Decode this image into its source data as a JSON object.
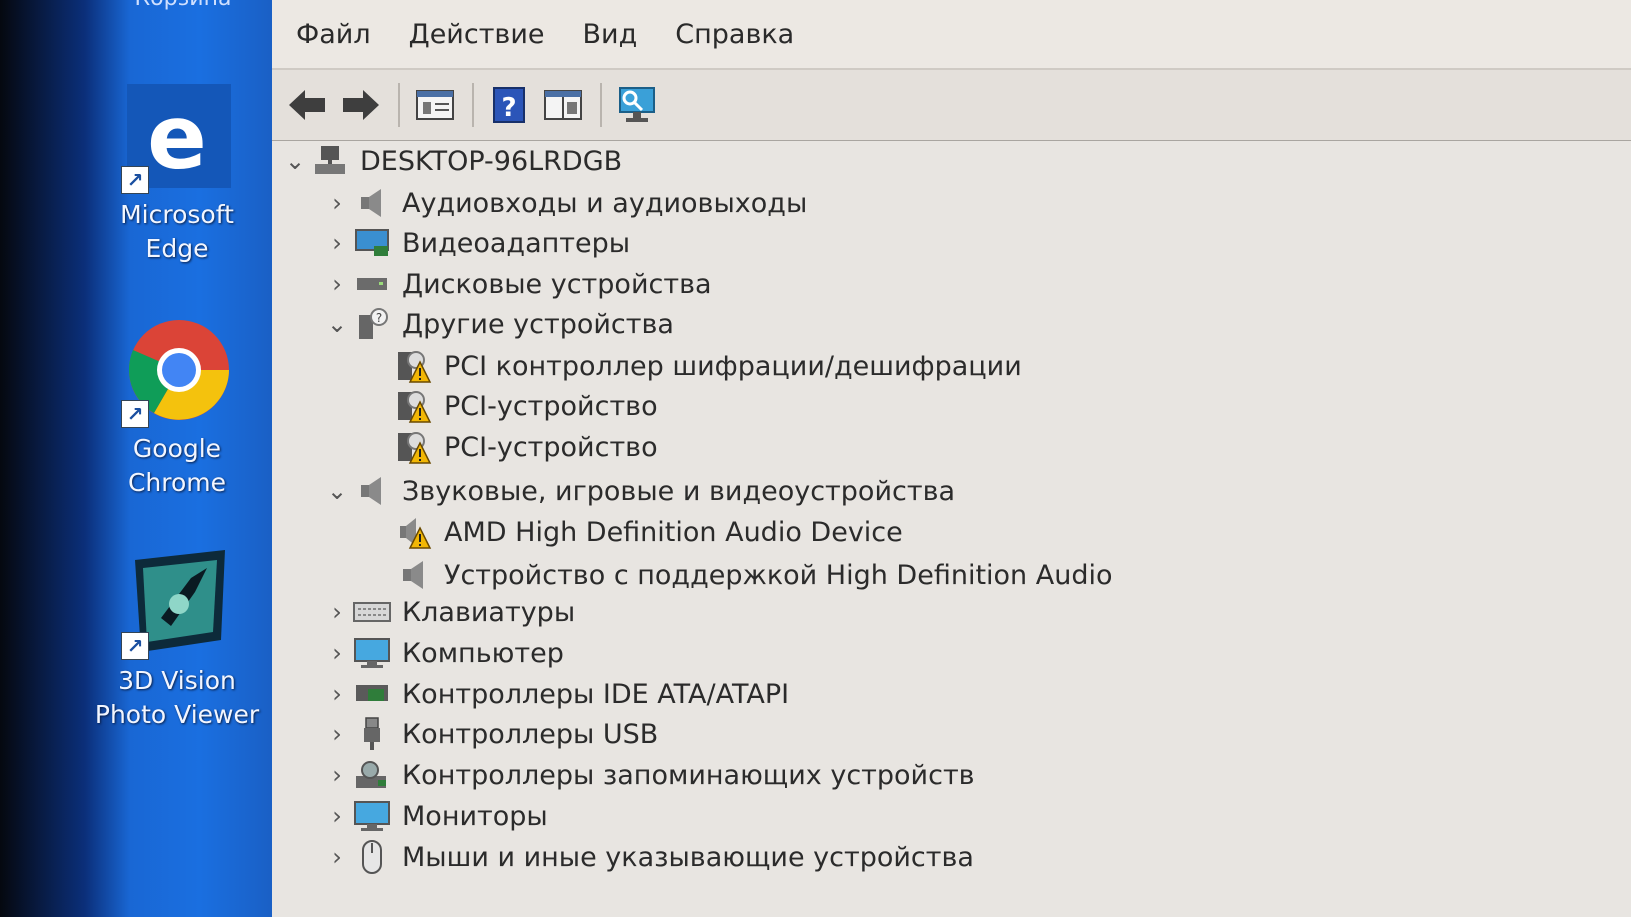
{
  "desktop": {
    "partial_top_label": "Корзина",
    "shortcuts": [
      {
        "label": "Microsoft\nEdge",
        "icon": "edge-icon"
      },
      {
        "label": "Google\nChrome",
        "icon": "chrome-icon"
      },
      {
        "label": "3D Vision\nPhoto Viewer",
        "icon": "3d-vision-icon"
      }
    ]
  },
  "menu": {
    "file": "Файл",
    "action": "Действие",
    "view": "Вид",
    "help": "Справка"
  },
  "toolbar": {
    "icons": [
      "back-arrow-icon",
      "forward-arrow-icon",
      "properties-icon",
      "help-icon",
      "console-tree-icon",
      "scan-hardware-icon"
    ]
  },
  "tree": {
    "root": "DESKTOP-96LRDGB",
    "items": [
      {
        "label": "Аудиовходы и аудиовыходы",
        "expanded": false
      },
      {
        "label": "Видеоадаптеры",
        "expanded": false
      },
      {
        "label": "Дисковые устройства",
        "expanded": false
      },
      {
        "label": "Другие устройства",
        "expanded": true
      },
      {
        "label": "PCI контроллер шифрации/дешифрации",
        "child": true,
        "warning": true
      },
      {
        "label": "PCI-устройство",
        "child": true,
        "warning": true
      },
      {
        "label": "PCI-устройство",
        "child": true,
        "warning": true
      },
      {
        "label": "Звуковые, игровые и видеоустройства",
        "expanded": true
      },
      {
        "label": "AMD High Definition Audio Device",
        "child": true,
        "warning": true
      },
      {
        "label": "Устройство с поддержкой High Definition Audio",
        "child": true,
        "warning": false
      },
      {
        "label": "Клавиатуры",
        "expanded": false
      },
      {
        "label": "Компьютер",
        "expanded": false
      },
      {
        "label": "Контроллеры IDE ATA/ATAPI",
        "expanded": false
      },
      {
        "label": "Контроллеры USB",
        "expanded": false
      },
      {
        "label": "Контроллеры запоминающих устройств",
        "expanded": false
      },
      {
        "label": "Мониторы",
        "expanded": false
      },
      {
        "label": "Мыши и иные указывающие устройства",
        "expanded": false
      }
    ]
  },
  "colors": {
    "desktop_blue": "#1a6fe0",
    "window_bg": "#e8e5e1",
    "warning_yellow": "#f2b705"
  }
}
